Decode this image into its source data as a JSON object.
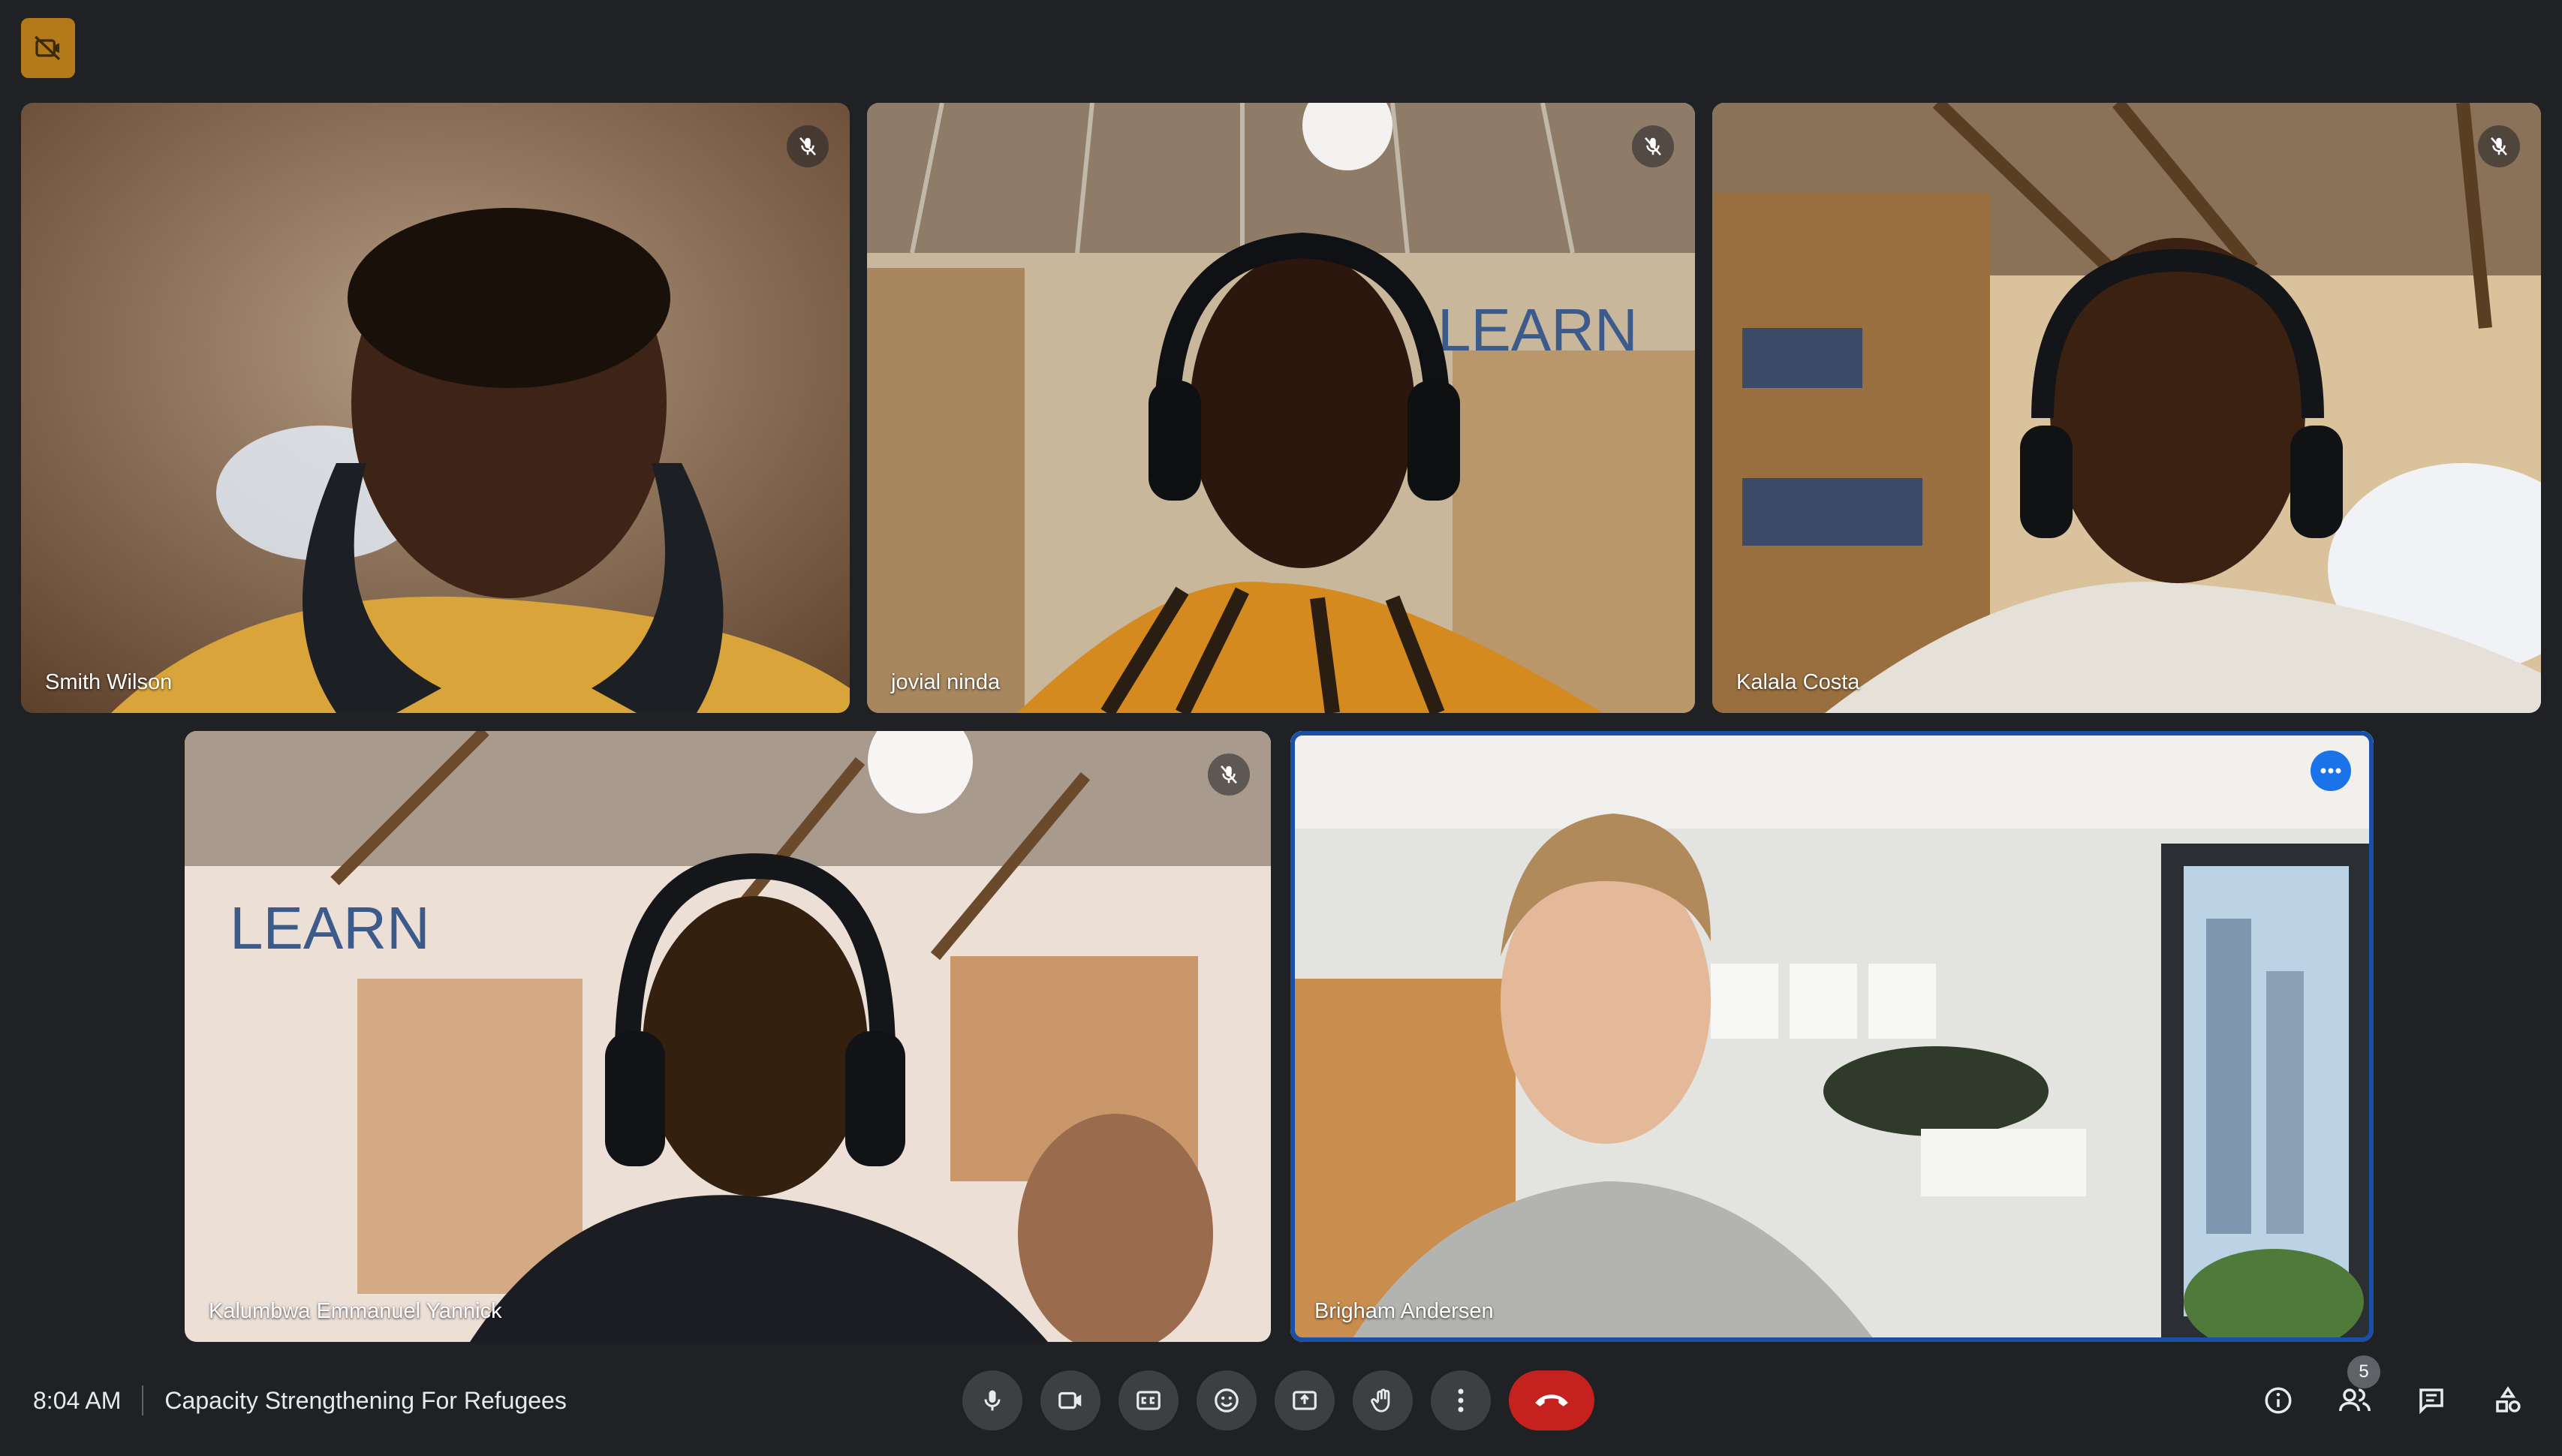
{
  "meeting": {
    "time": "8:04 AM",
    "title": "Capacity Strengthening For Refugees"
  },
  "participants": [
    {
      "name": "Smith Wilson",
      "muted": true
    },
    {
      "name": "jovial ninda",
      "muted": true
    },
    {
      "name": "Kalala Costa",
      "muted": true
    },
    {
      "name": "Kalumbwa Emmanuel Yannick",
      "muted": true
    },
    {
      "name": "Brigham Andersen",
      "muted": false,
      "active": true
    }
  ],
  "scene_text": {
    "wall_sign": "LEARN"
  },
  "people_count": "5",
  "icons": {
    "top_badge": "camera-off-icon",
    "mute": "mic-off-icon",
    "more": "more-options-icon",
    "controls": [
      "mic-icon",
      "camera-icon",
      "captions-icon",
      "emoji-icon",
      "present-icon",
      "raise-hand-icon",
      "more-vert-icon",
      "end-call-icon"
    ],
    "right": [
      "info-icon",
      "people-icon",
      "chat-icon",
      "activities-icon"
    ]
  },
  "colors": {
    "background": "#202124",
    "active_border": "#1a4fa8",
    "end_call": "#c5221f",
    "badge": "#b3791a"
  }
}
